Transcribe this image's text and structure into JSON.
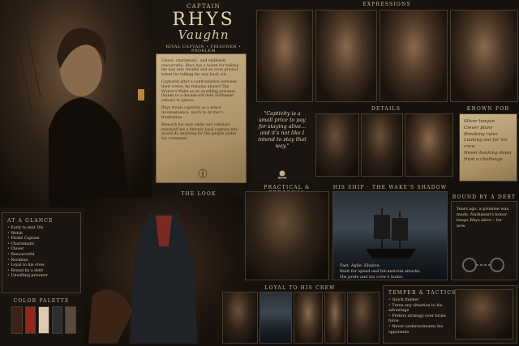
{
  "title": {
    "top": "CAPTAIN",
    "name": "RHYS",
    "surname": "Vaughn",
    "tagline": "RIVAL CAPTAIN • PRISONER • PROBLEM"
  },
  "bio": {
    "p1": "Clever, charismatic, and endlessly resourceful, Rhys has a talent for talking his way into trouble and an even greater talent for talking his way back out.",
    "p2": "Captured after a confrontation between their crews, he remains aboard The Widow's Wake as an unwilling prisoner, thanks to a decade-old debt Nathaniel refuses to ignore.",
    "p3": "Rhys treats captivity as a minor inconvenience, much to Archer's frustration.",
    "p4": "Beneath his easy smile and constant mischief lies a fiercely loyal captain who would do anything for the people under his command."
  },
  "sections": {
    "expressions": "EXPRESSIONS",
    "details": "DETAILS",
    "known_for": "KNOWN FOR",
    "the_look": "THE LOOK",
    "practical": "PRACTICAL & PERSONAL",
    "ship": "HIS SHIP · THE WAKE'S SHADOW",
    "debt": "BOUND BY A DEBT",
    "glance": "AT A GLANCE",
    "palette": "COLOR PALETTE",
    "loyal": "LOYAL TO HIS CREW",
    "temper": "TEMPER & TACTICS"
  },
  "quote": "\"Captivity is a small price to pay for staying alive... and it's not like I intend to stay that way.\"",
  "known_for": [
    "Silver tongue",
    "Clever plans",
    "Breaking rules",
    "Looking out for his crew",
    "Never backing down from a challenge"
  ],
  "glance": [
    "Early to mid 30s",
    "Welsh",
    "Pirate Captain",
    "Charismatic",
    "Clever",
    "Resourceful",
    "Reckless",
    "Loyal to his crew",
    "Bound by a debt",
    "Unwilling prisoner"
  ],
  "ship": {
    "line1": "Fast. Agile. Elusive.",
    "line2": "Built for speed and hit-and-run attacks.",
    "line3": "His pride and his crew's home."
  },
  "debt": {
    "text": "Years ago, a promise was made. Nathaniel's honor keeps Rhys alive— for now."
  },
  "temper": [
    "Quick thinker",
    "Turns any situation to his advantage",
    "Prefers strategy over brute force",
    "Never underestimates his opponents"
  ],
  "palette": {
    "colors": [
      "#3a2418",
      "#8c2a22",
      "#d9cbb4",
      "#2a2f33",
      "#5a4a3e"
    ]
  }
}
